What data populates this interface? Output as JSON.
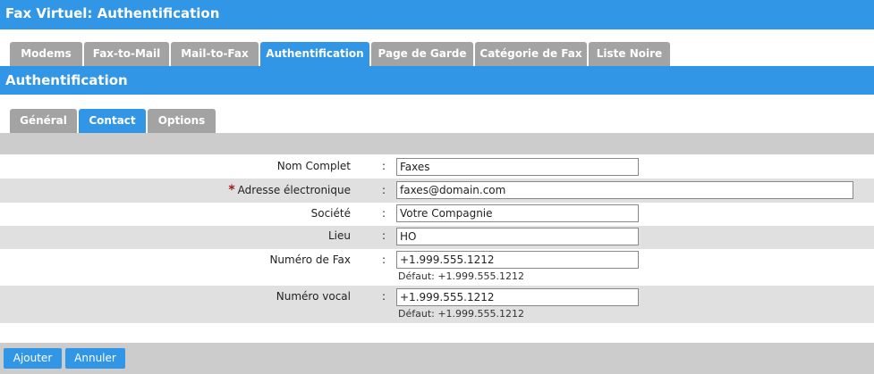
{
  "header": {
    "title": "Fax Virtuel:  Authentification"
  },
  "tabs": [
    {
      "label": "Modems"
    },
    {
      "label": "Fax-to-Mail"
    },
    {
      "label": "Mail-to-Fax"
    },
    {
      "label": "Authentification",
      "active": true
    },
    {
      "label": "Page de Garde"
    },
    {
      "label": "Catégorie de Fax"
    },
    {
      "label": "Liste Noire"
    }
  ],
  "section": {
    "title": "Authentification"
  },
  "subtabs": [
    {
      "label": "Général"
    },
    {
      "label": "Contact",
      "active": true
    },
    {
      "label": "Options"
    }
  ],
  "form": {
    "colon": ":",
    "required_mark": "*",
    "fields": [
      {
        "label": "Nom Complet",
        "value": "Faxes"
      },
      {
        "label": "Adresse électronique",
        "value": "faxes@domain.com",
        "required": true
      },
      {
        "label": "Société",
        "value": "Votre Compagnie"
      },
      {
        "label": "Lieu",
        "value": "HO"
      },
      {
        "label": "Numéro de Fax",
        "value": "+1.999.555.1212",
        "hint": "Défaut: +1.999.555.1212"
      },
      {
        "label": "Numéro vocal",
        "value": "+1.999.555.1212",
        "hint": "Défaut: +1.999.555.1212"
      }
    ]
  },
  "buttons": {
    "add": "Ajouter",
    "cancel": "Annuler"
  },
  "colors": {
    "accent": "#3296e6",
    "tab_inactive": "#a3a3a3",
    "row_alt": "#e0e0e0",
    "required": "#a01818"
  }
}
